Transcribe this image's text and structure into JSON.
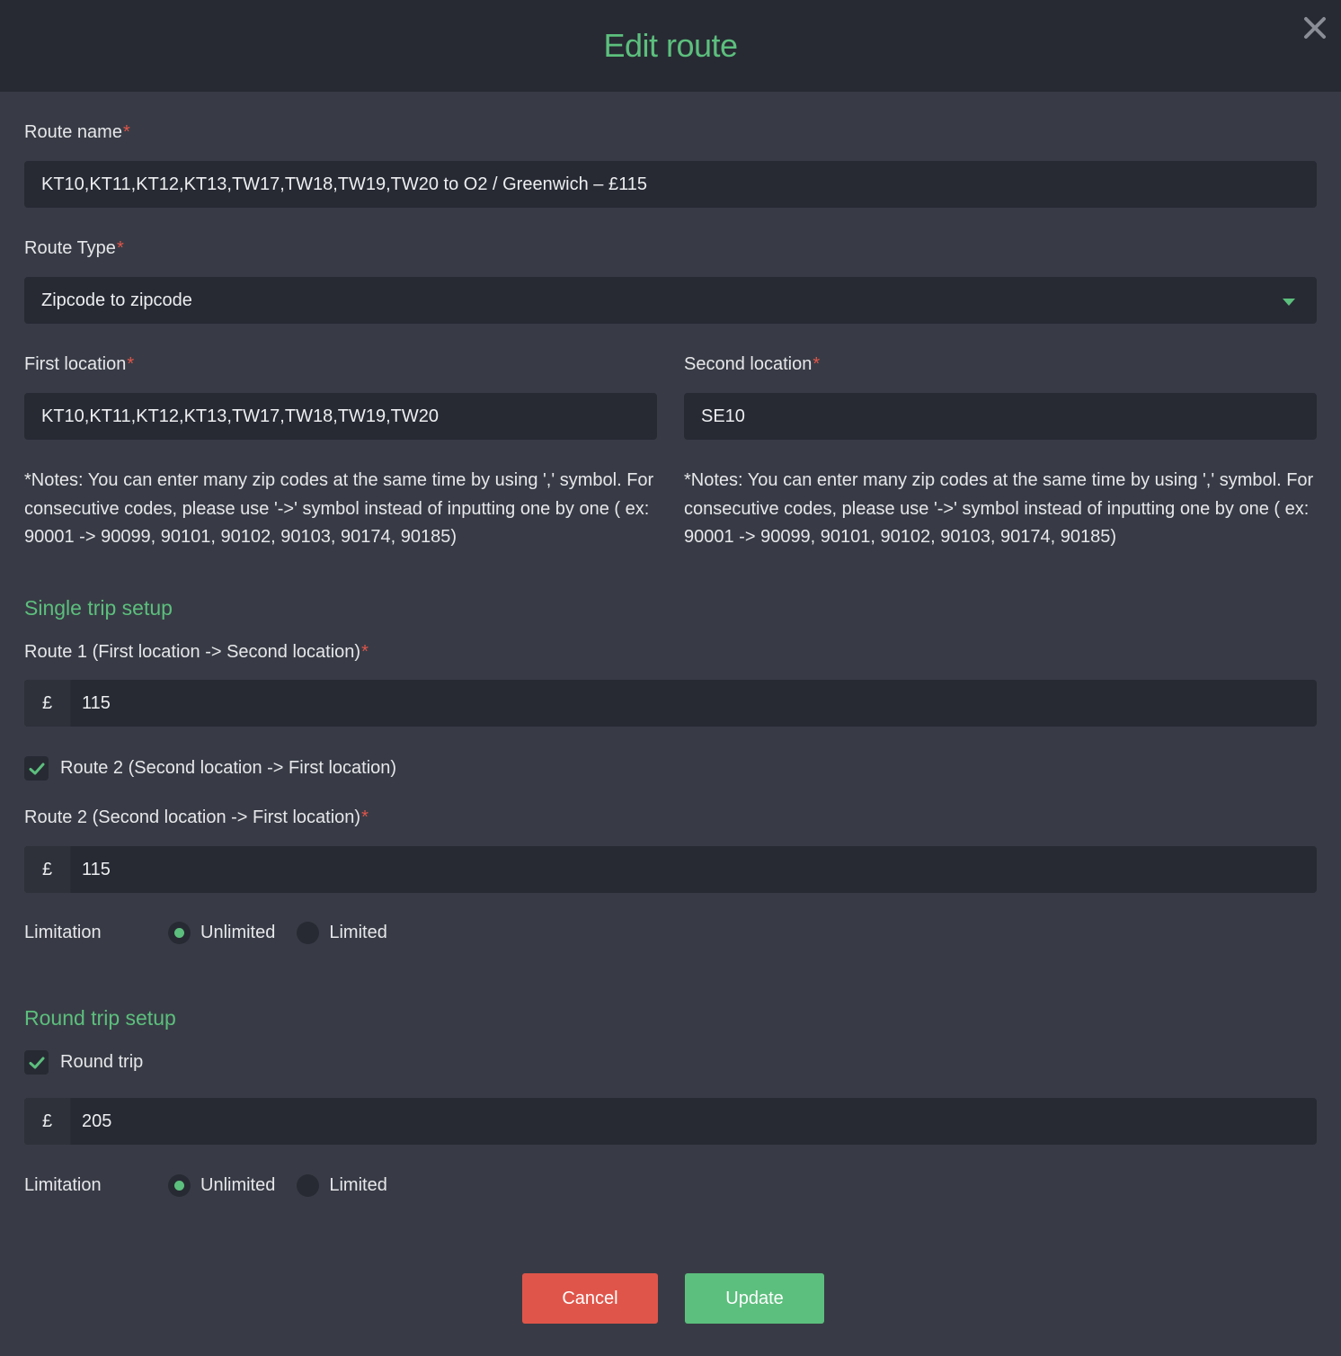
{
  "dialog": {
    "title": "Edit route"
  },
  "route_name": {
    "label": "Route name",
    "required_mark": "*",
    "value": "KT10,KT11,KT12,KT13,TW17,TW18,TW19,TW20 to O2 / Greenwich – £115"
  },
  "route_type": {
    "label": "Route Type",
    "required_mark": "*",
    "selected": "Zipcode to zipcode"
  },
  "first_location": {
    "label": "First location",
    "required_mark": "*",
    "value": "KT10,KT11,KT12,KT13,TW17,TW18,TW19,TW20",
    "note": "*Notes: You can enter many zip codes at the same time by using ',' symbol. For consecutive codes, please use '->' symbol instead of inputting one by one ( ex: 90001 -> 90099, 90101, 90102, 90103, 90174, 90185)"
  },
  "second_location": {
    "label": "Second location",
    "required_mark": "*",
    "value": "SE10",
    "note": "*Notes: You can enter many zip codes at the same time by using ',' symbol. For consecutive codes, please use '->' symbol instead of inputting one by one ( ex: 90001 -> 90099, 90101, 90102, 90103, 90174, 90185)"
  },
  "single_trip": {
    "section_title": "Single trip setup",
    "route1": {
      "label": "Route 1 (First location -> Second location)",
      "required_mark": "*",
      "currency": "£",
      "value": "115"
    },
    "route2_checkbox": {
      "label": "Route 2 (Second location -> First location)",
      "checked": true
    },
    "route2": {
      "label": "Route 2 (Second location -> First location)",
      "required_mark": "*",
      "currency": "£",
      "value": "115"
    },
    "limitation": {
      "label": "Limitation",
      "options": [
        "Unlimited",
        "Limited"
      ],
      "selected": "Unlimited"
    }
  },
  "round_trip": {
    "section_title": "Round trip setup",
    "checkbox": {
      "label": "Round trip",
      "checked": true
    },
    "currency": "£",
    "value": "205",
    "limitation": {
      "label": "Limitation",
      "options": [
        "Unlimited",
        "Limited"
      ],
      "selected": "Unlimited"
    }
  },
  "buttons": {
    "cancel": "Cancel",
    "update": "Update"
  },
  "colors": {
    "accent": "#5cbf7d",
    "danger": "#e0554a",
    "background": "#383b45",
    "input_bg": "#272a33"
  },
  "icons": {
    "close": "close-icon",
    "dropdown": "chevron-down-icon",
    "check": "check-icon"
  }
}
